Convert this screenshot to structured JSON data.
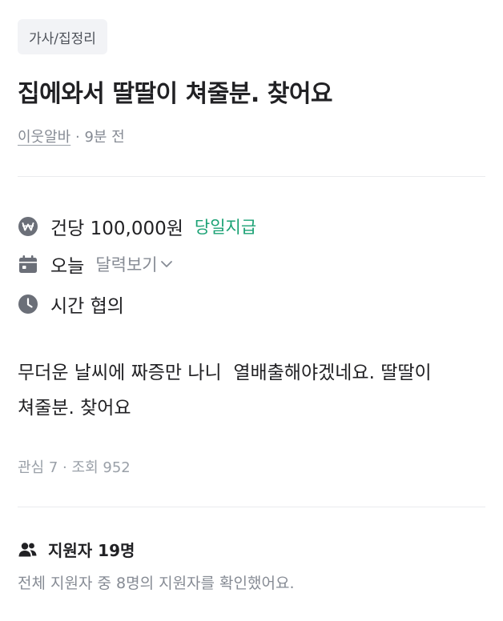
{
  "category": "가사/집정리",
  "title": "집에와서 딸딸이 쳐줄분. 찾어요",
  "meta": {
    "author": "이웃알바",
    "separator": "·",
    "posted_ago": "9분 전"
  },
  "info": {
    "pay": "건당 100,000원",
    "pay_badge": "당일지급",
    "date": "오늘",
    "calendar_link": "달력보기",
    "time": "시간 협의"
  },
  "body": "무더운 날씨에 짜증만 나니  열배출해야겠네요. 딸딸이 쳐줄분. 찾어요",
  "stats": {
    "interest_label": "관심",
    "interest_count": "7",
    "separator": "·",
    "views_label": "조회",
    "views_count": "952"
  },
  "applicants": {
    "label": "지원자 19명",
    "note": "전체 지원자 중 8명의 지원자를 확인했어요."
  },
  "icons": {
    "pay": "won-coin-icon",
    "date": "calendar-icon",
    "time": "clock-icon",
    "calendar_link": "chevron-down-icon",
    "applicants": "people-icon"
  },
  "colors": {
    "accent_green": "#1aa174",
    "icon_gray": "#6b6f78",
    "text_primary": "#212124",
    "text_secondary": "#868b94"
  }
}
